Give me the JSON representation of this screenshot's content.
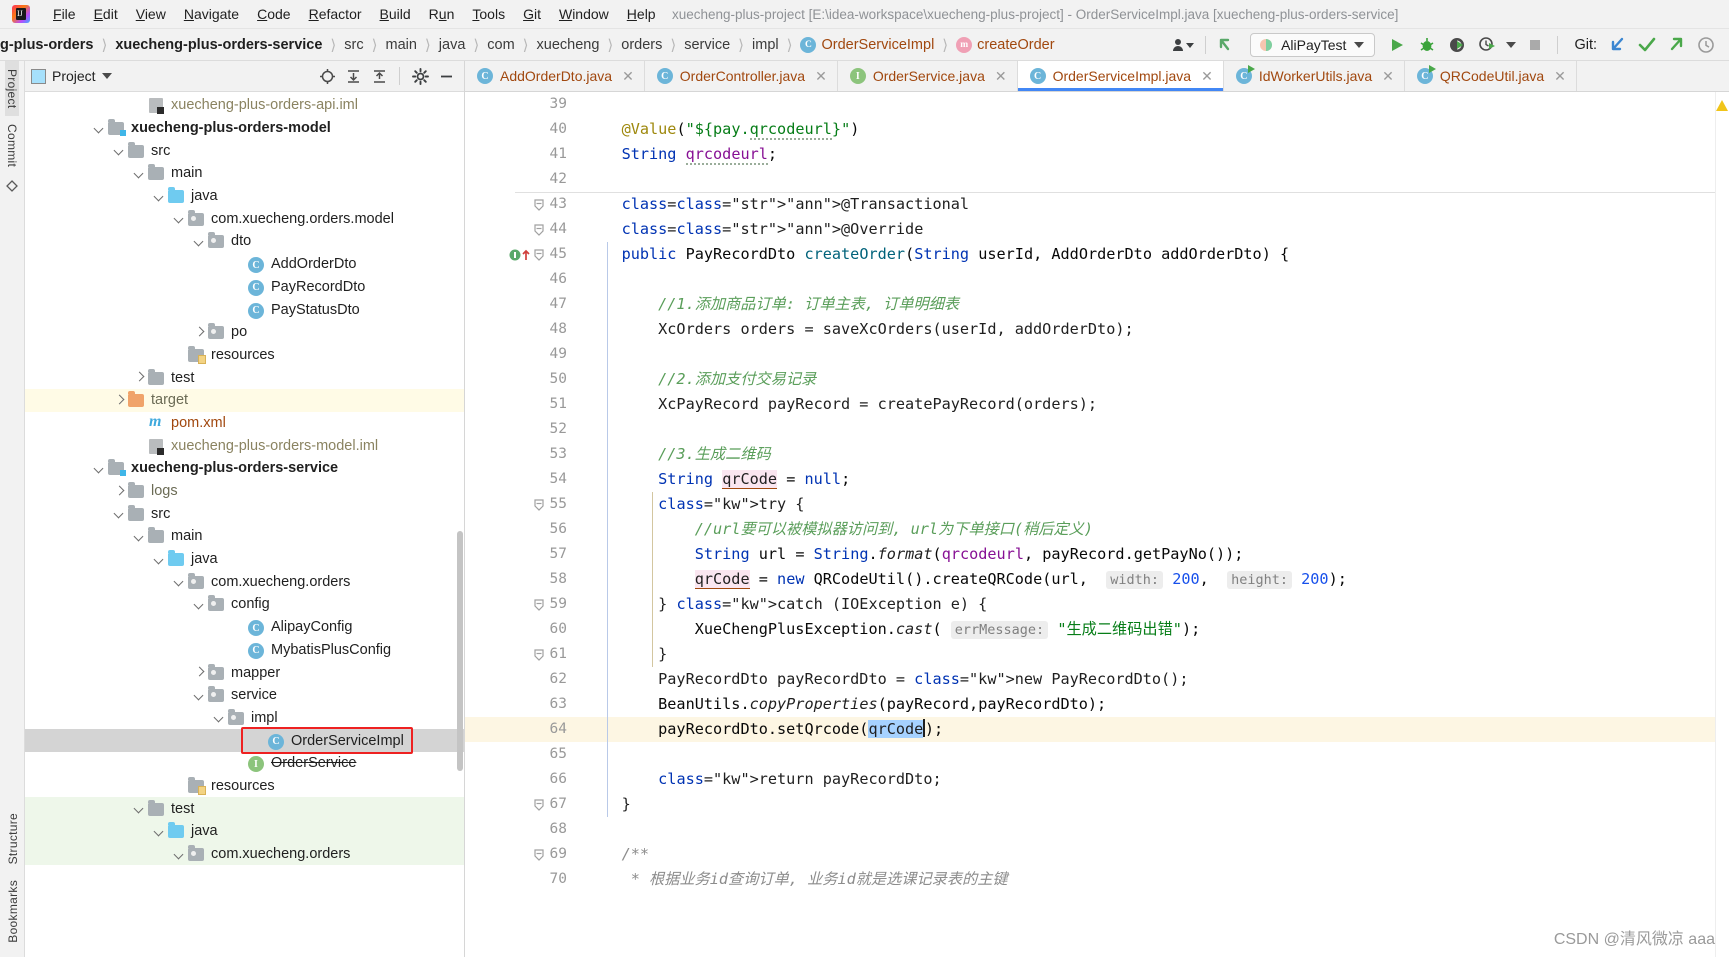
{
  "window": {
    "title": "xuecheng-plus-project [E:\\idea-workspace\\xuecheng-plus-project] - OrderServiceImpl.java [xuecheng-plus-orders-service]"
  },
  "menubar": {
    "items": [
      "File",
      "Edit",
      "View",
      "Navigate",
      "Code",
      "Refactor",
      "Build",
      "Run",
      "Tools",
      "Git",
      "Window",
      "Help"
    ]
  },
  "breadcrumb": {
    "items": [
      {
        "label": "g-plus-orders",
        "style": "bold"
      },
      {
        "label": "xuecheng-plus-orders-service",
        "style": "bold"
      },
      {
        "label": "src",
        "style": "plain"
      },
      {
        "label": "main",
        "style": "plain"
      },
      {
        "label": "java",
        "style": "plain"
      },
      {
        "label": "com",
        "style": "plain"
      },
      {
        "label": "xuecheng",
        "style": "plain"
      },
      {
        "label": "orders",
        "style": "plain"
      },
      {
        "label": "service",
        "style": "plain"
      },
      {
        "label": "impl",
        "style": "plain"
      },
      {
        "label": "OrderServiceImpl",
        "style": "class",
        "icon": "c"
      },
      {
        "label": "createOrder",
        "style": "class",
        "icon": "m"
      }
    ]
  },
  "toolbar": {
    "run_config": "AliPayTest",
    "git_label": "Git:",
    "icons": [
      "user-chooser-icon",
      "back-arrow-icon",
      "run-icon",
      "debug-icon",
      "run-with-coverage-icon",
      "profiler-icon",
      "stop-icon",
      "git-update-icon",
      "git-commit-icon",
      "git-push-icon",
      "git-history-icon"
    ]
  },
  "left_strip": {
    "top": [
      "Project",
      "Commit"
    ],
    "bottom": [
      "Bookmarks",
      "Structure"
    ]
  },
  "project_panel": {
    "title": "Project",
    "actions": [
      "locate-icon",
      "expand-all-icon",
      "collapse-all-icon",
      "settings-icon",
      "hide-icon"
    ],
    "tree": [
      {
        "indent": 5,
        "arrow": "none",
        "icon": "iml",
        "label": "xuecheng-plus-orders-api.iml",
        "style": "iml"
      },
      {
        "indent": 3,
        "arrow": "open",
        "icon": "module",
        "label": "xuecheng-plus-orders-model",
        "style": "bold"
      },
      {
        "indent": 4,
        "arrow": "open",
        "icon": "folder",
        "label": "src",
        "style": "plain"
      },
      {
        "indent": 5,
        "arrow": "open",
        "icon": "folder",
        "label": "main",
        "style": "plain"
      },
      {
        "indent": 6,
        "arrow": "open",
        "icon": "folder-blue",
        "label": "java",
        "style": "plain"
      },
      {
        "indent": 7,
        "arrow": "open",
        "icon": "package",
        "label": "com.xuecheng.orders.model",
        "style": "plain"
      },
      {
        "indent": 8,
        "arrow": "open",
        "icon": "package",
        "label": "dto",
        "style": "plain"
      },
      {
        "indent": 10,
        "arrow": "none",
        "icon": "class",
        "label": "AddOrderDto",
        "style": "class"
      },
      {
        "indent": 10,
        "arrow": "none",
        "icon": "class",
        "label": "PayRecordDto",
        "style": "class"
      },
      {
        "indent": 10,
        "arrow": "none",
        "icon": "class",
        "label": "PayStatusDto",
        "style": "class"
      },
      {
        "indent": 8,
        "arrow": "closed",
        "icon": "package",
        "label": "po",
        "style": "plain"
      },
      {
        "indent": 7,
        "arrow": "none",
        "icon": "resources",
        "label": "resources",
        "style": "plain"
      },
      {
        "indent": 5,
        "arrow": "closed",
        "icon": "folder",
        "label": "test",
        "style": "plain"
      },
      {
        "indent": 4,
        "arrow": "closed",
        "icon": "folder-orange",
        "label": "target",
        "style": "dim",
        "highlight": "yellow"
      },
      {
        "indent": 5,
        "arrow": "none",
        "icon": "maven",
        "label": "pom.xml",
        "style": "pom"
      },
      {
        "indent": 5,
        "arrow": "none",
        "icon": "iml",
        "label": "xuecheng-plus-orders-model.iml",
        "style": "iml"
      },
      {
        "indent": 3,
        "arrow": "open",
        "icon": "module",
        "label": "xuecheng-plus-orders-service",
        "style": "bold"
      },
      {
        "indent": 4,
        "arrow": "closed",
        "icon": "folder",
        "label": "logs",
        "style": "dim"
      },
      {
        "indent": 4,
        "arrow": "open",
        "icon": "folder",
        "label": "src",
        "style": "plain"
      },
      {
        "indent": 5,
        "arrow": "open",
        "icon": "folder",
        "label": "main",
        "style": "plain"
      },
      {
        "indent": 6,
        "arrow": "open",
        "icon": "folder-blue",
        "label": "java",
        "style": "plain"
      },
      {
        "indent": 7,
        "arrow": "open",
        "icon": "package",
        "label": "com.xuecheng.orders",
        "style": "plain"
      },
      {
        "indent": 8,
        "arrow": "open",
        "icon": "package",
        "label": "config",
        "style": "plain"
      },
      {
        "indent": 10,
        "arrow": "none",
        "icon": "class",
        "label": "AlipayConfig",
        "style": "class"
      },
      {
        "indent": 10,
        "arrow": "none",
        "icon": "class",
        "label": "MybatisPlusConfig",
        "style": "class"
      },
      {
        "indent": 8,
        "arrow": "closed",
        "icon": "package",
        "label": "mapper",
        "style": "plain"
      },
      {
        "indent": 8,
        "arrow": "open",
        "icon": "package",
        "label": "service",
        "style": "plain"
      },
      {
        "indent": 9,
        "arrow": "open",
        "icon": "package",
        "label": "impl",
        "style": "plain"
      },
      {
        "indent": 11,
        "arrow": "none",
        "icon": "class",
        "label": "OrderServiceImpl",
        "style": "class",
        "selected": true,
        "annotated": true
      },
      {
        "indent": 10,
        "arrow": "none",
        "icon": "interface",
        "label": "OrderService",
        "style": "class strike"
      },
      {
        "indent": 7,
        "arrow": "none",
        "icon": "resources",
        "label": "resources",
        "style": "plain"
      },
      {
        "indent": 5,
        "arrow": "open",
        "icon": "folder",
        "label": "test",
        "style": "plain",
        "highlight": "green"
      },
      {
        "indent": 6,
        "arrow": "open",
        "icon": "folder-blue",
        "label": "java",
        "style": "plain",
        "highlight": "green"
      },
      {
        "indent": 7,
        "arrow": "open",
        "icon": "package",
        "label": "com.xuecheng.orders",
        "style": "plain",
        "highlight": "green"
      }
    ]
  },
  "editor_tabs": [
    {
      "label": "AddOrderDto.java",
      "icon": "class",
      "active": false,
      "runnable": false
    },
    {
      "label": "OrderController.java",
      "icon": "class",
      "active": false,
      "runnable": false
    },
    {
      "label": "OrderService.java",
      "icon": "interface",
      "active": false,
      "runnable": false
    },
    {
      "label": "OrderServiceImpl.java",
      "icon": "class",
      "active": true,
      "runnable": false
    },
    {
      "label": "IdWorkerUtils.java",
      "icon": "class",
      "active": false,
      "runnable": true
    },
    {
      "label": "QRCodeUtil.java",
      "icon": "class",
      "active": false,
      "runnable": true
    }
  ],
  "code": {
    "first_line": 39,
    "highlighted_line": 64,
    "lines": [
      {
        "n": 39,
        "text": ""
      },
      {
        "n": 40,
        "text": "    @Value(\"${pay.qrcodeurl}\")"
      },
      {
        "n": 41,
        "text": "    String qrcodeurl;"
      },
      {
        "n": 42,
        "text": ""
      },
      {
        "n": 43,
        "text": "    @Transactional"
      },
      {
        "n": 44,
        "text": "    @Override"
      },
      {
        "n": 45,
        "text": "    public PayRecordDto createOrder(String userId, AddOrderDto addOrderDto) {"
      },
      {
        "n": 46,
        "text": ""
      },
      {
        "n": 47,
        "text": "        //1.添加商品订单: 订单主表, 订单明细表"
      },
      {
        "n": 48,
        "text": "        XcOrders orders = saveXcOrders(userId, addOrderDto);"
      },
      {
        "n": 49,
        "text": ""
      },
      {
        "n": 50,
        "text": "        //2.添加支付交易记录"
      },
      {
        "n": 51,
        "text": "        XcPayRecord payRecord = createPayRecord(orders);"
      },
      {
        "n": 52,
        "text": ""
      },
      {
        "n": 53,
        "text": "        //3.生成二维码"
      },
      {
        "n": 54,
        "text": "        String qrCode = null;"
      },
      {
        "n": 55,
        "text": "        try {"
      },
      {
        "n": 56,
        "text": "            //url要可以被模拟器访问到, url为下单接口(稍后定义)"
      },
      {
        "n": 57,
        "text": "            String url = String.format(qrcodeurl, payRecord.getPayNo());"
      },
      {
        "n": 58,
        "text": "            qrCode = new QRCodeUtil().createQRCode(url,  width: 200,  height: 200);"
      },
      {
        "n": 59,
        "text": "        } catch (IOException e) {"
      },
      {
        "n": 60,
        "text": "            XueChengPlusException.cast( errMessage: \"生成二维码出错\");"
      },
      {
        "n": 61,
        "text": "        }"
      },
      {
        "n": 62,
        "text": "        PayRecordDto payRecordDto = new PayRecordDto();"
      },
      {
        "n": 63,
        "text": "        BeanUtils.copyProperties(payRecord,payRecordDto);"
      },
      {
        "n": 64,
        "text": "        payRecordDto.setQrcode(qrCode);"
      },
      {
        "n": 65,
        "text": ""
      },
      {
        "n": 66,
        "text": "        return payRecordDto;"
      },
      {
        "n": 67,
        "text": "    }"
      },
      {
        "n": 68,
        "text": ""
      },
      {
        "n": 69,
        "text": "    /**"
      },
      {
        "n": 70,
        "text": "     * 根据业务id查询订单, 业务id就是选课记录表的主键"
      }
    ],
    "param_hints": [
      {
        "line": 58,
        "name": "width:",
        "value": "200"
      },
      {
        "line": 58,
        "name": "height:",
        "value": "200"
      },
      {
        "line": 60,
        "name": "errMessage:",
        "value": "\"生成二维码出错\""
      }
    ],
    "selection": {
      "line": 64,
      "text": "qrCode"
    }
  },
  "watermark": "CSDN @清风微凉 aaa",
  "colors": {
    "accent_blue": "#4287f5",
    "annotation_red": "#ee2121",
    "keyword": "#0033b3",
    "string": "#067d17",
    "comment": "#8c8c8c",
    "class_name": "#a1480f",
    "number": "#1750eb",
    "field": "#871094",
    "method": "#00627a"
  }
}
